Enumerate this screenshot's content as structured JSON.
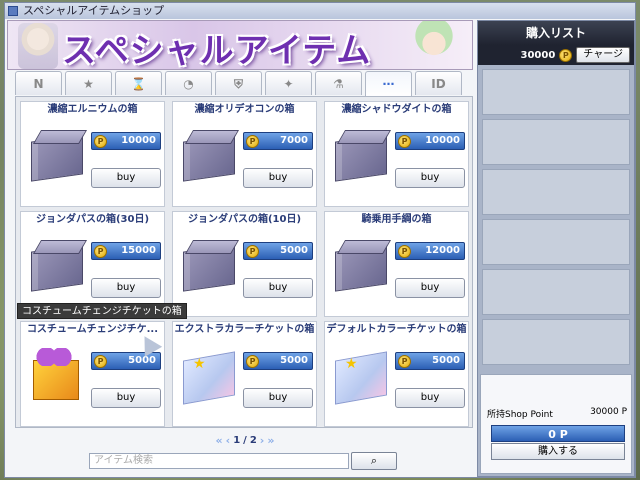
{
  "window": {
    "title": "スペシャルアイテムショップ"
  },
  "banner": {
    "title": "スペシャルアイテム"
  },
  "cart": {
    "header": "購入リスト",
    "balance": "30000",
    "charge_label": "チャージ",
    "shop_point_label": "所持Shop Point",
    "shop_point_value": "30000 P",
    "op_label": "0 P",
    "buy_all_label": "購入する"
  },
  "tabs": [
    {
      "label": "N",
      "icon": "new-icon"
    },
    {
      "label": "★",
      "icon": "star-icon"
    },
    {
      "label": "⌛",
      "icon": "hourglass-icon"
    },
    {
      "label": "◔",
      "icon": "clock-icon"
    },
    {
      "label": "⛨",
      "icon": "shield-icon"
    },
    {
      "label": "✦",
      "icon": "sparkle-icon"
    },
    {
      "label": "⚗",
      "icon": "potion-icon"
    },
    {
      "label": "⋯",
      "icon": "more-icon"
    },
    {
      "label": "ID",
      "icon": "id-icon"
    }
  ],
  "items": [
    {
      "name": "濃縮エルニウムの箱",
      "price": "10000",
      "buy": "buy",
      "image": "box"
    },
    {
      "name": "濃縮オリデオコンの箱",
      "price": "7000",
      "buy": "buy",
      "image": "box"
    },
    {
      "name": "濃縮シャドウダイトの箱",
      "price": "10000",
      "buy": "buy",
      "image": "box"
    },
    {
      "name": "ジョンダパスの箱(30日)",
      "price": "15000",
      "buy": "buy",
      "image": "box"
    },
    {
      "name": "ジョンダパスの箱(10日)",
      "price": "5000",
      "buy": "buy",
      "image": "box"
    },
    {
      "name": "騎乗用手綱の箱",
      "price": "12000",
      "buy": "buy",
      "image": "box"
    },
    {
      "name": "コスチュームチェンジチケ...",
      "price": "5000",
      "buy": "buy",
      "image": "gift"
    },
    {
      "name": "エクストラカラーチケットの箱",
      "price": "5000",
      "buy": "buy",
      "image": "ticket"
    },
    {
      "name": "デフォルトカラーチケットの箱",
      "price": "5000",
      "buy": "buy",
      "image": "ticket"
    }
  ],
  "tooltip": "コスチュームチェンジチケットの箱",
  "pager": {
    "current": "1",
    "separator": "/",
    "total": "2"
  },
  "search": {
    "placeholder": "アイテム検索",
    "button_icon": "search-icon"
  },
  "colors": {
    "accent": "#2c5fb4",
    "title_purple": "#6e2fb0"
  }
}
